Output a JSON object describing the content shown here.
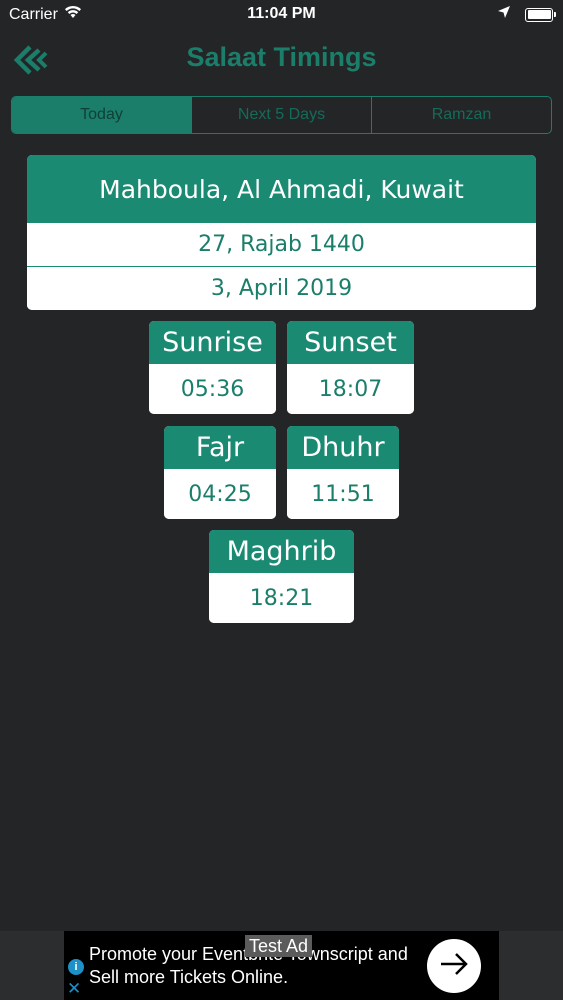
{
  "status_bar": {
    "carrier": "Carrier",
    "time": "11:04 PM",
    "icons": [
      "wifi-icon",
      "location-arrow-icon",
      "battery-icon"
    ]
  },
  "nav": {
    "title": "Salaat Timings",
    "back_icon": "double-chevron-left-icon"
  },
  "segments": [
    {
      "label": "Today",
      "active": true
    },
    {
      "label": "Next 5 Days",
      "active": false
    },
    {
      "label": "Ramzan",
      "active": false
    }
  ],
  "location": {
    "name": "Mahboula, Al Ahmadi, Kuwait",
    "hijri_date": "27, Rajab 1440",
    "gregorian_date": "3, April 2019"
  },
  "prayers": [
    {
      "name": "Sunrise",
      "time": "05:36"
    },
    {
      "name": "Sunset",
      "time": "18:07"
    },
    {
      "name": "Fajr",
      "time": "04:25"
    },
    {
      "name": "Dhuhr",
      "time": "11:51"
    },
    {
      "name": "Maghrib",
      "time": "18:21"
    }
  ],
  "ad": {
    "badge": "Test Ad",
    "text": "Promote your Eventbrite Townscript and Sell more Tickets Online.",
    "info_icon": "info-icon",
    "close_icon": "close-icon",
    "arrow_icon": "arrow-right-icon"
  },
  "colors": {
    "accent": "#1b8a73",
    "accent_dark": "#1b7e6a",
    "background": "#242526"
  }
}
